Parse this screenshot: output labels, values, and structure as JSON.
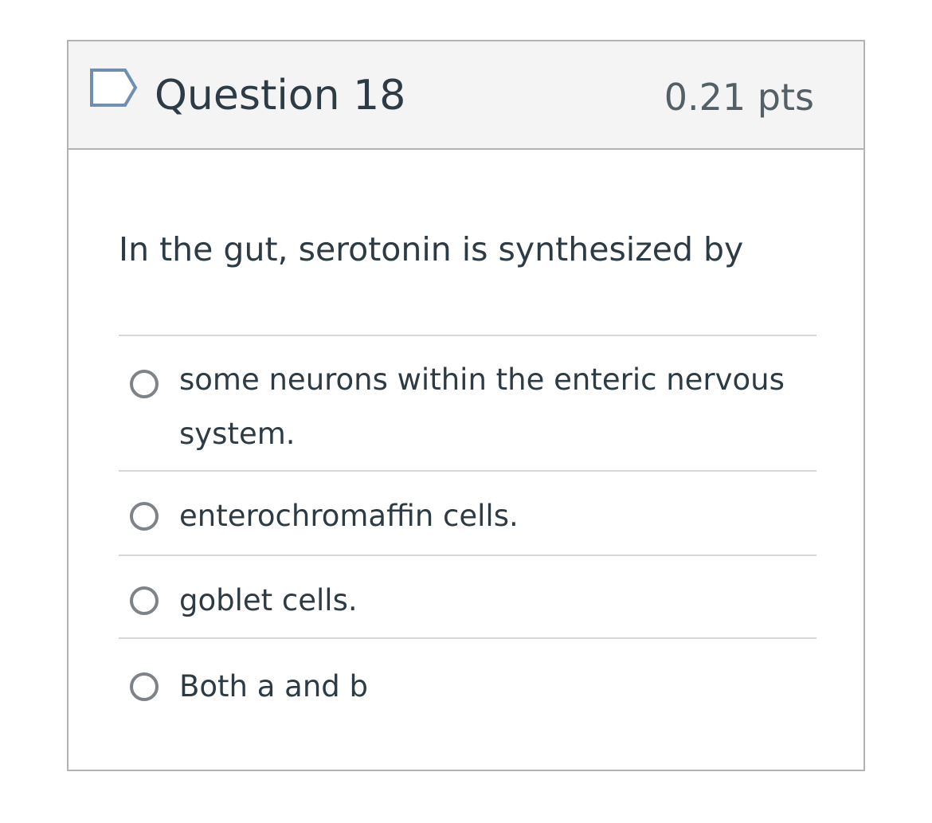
{
  "question": {
    "title": "Question 18",
    "points": "0.21 pts",
    "flag_icon": "flag-icon",
    "text": "In the gut, serotonin is synthesized by",
    "answers": [
      {
        "label": "some neurons within the enteric nervous system.",
        "selected": false
      },
      {
        "label": "enterochromaffin cells.",
        "selected": false
      },
      {
        "label": "goblet cells.",
        "selected": false
      },
      {
        "label": "Both a and b",
        "selected": false
      }
    ]
  },
  "colors": {
    "header_background": "#f4f4f4",
    "border": "#b3b3b3",
    "flag_outline": "#6f8fb0",
    "text": "#2d3b45",
    "radio_border": "#7d8388",
    "divider": "#d7d7d7"
  }
}
